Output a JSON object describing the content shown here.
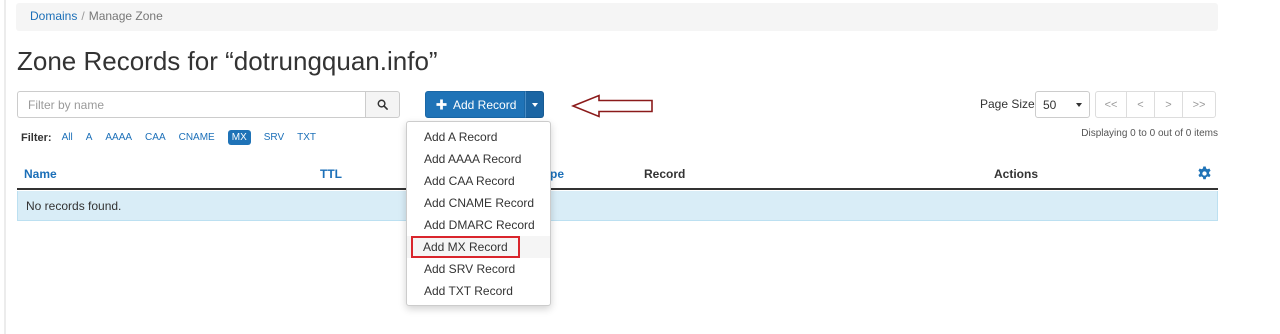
{
  "breadcrumb": {
    "link": "Domains",
    "separator": "/",
    "current": "Manage Zone"
  },
  "page_title": "Zone Records for “dotrungquan.info”",
  "search": {
    "placeholder": "Filter by name",
    "icon": "search-icon"
  },
  "add_record": {
    "label": "Add Record",
    "icon": "plus-icon",
    "color": "#1f73b7"
  },
  "dropdown": {
    "items": [
      "Add A Record",
      "Add AAAA Record",
      "Add CAA Record",
      "Add CNAME Record",
      "Add DMARC Record",
      "Add MX Record",
      "Add SRV Record",
      "Add TXT Record"
    ],
    "highlighted": "Add MX Record",
    "highlight_color": "#d9252c"
  },
  "page_size": {
    "label": "Page Size",
    "value": "50"
  },
  "pager": [
    "<<",
    "<",
    ">",
    ">>"
  ],
  "displaying": "Displaying 0 to 0 out of 0 items",
  "filter": {
    "label": "Filter:",
    "items": [
      "All",
      "A",
      "AAAA",
      "CAA",
      "CNAME",
      "MX",
      "SRV",
      "TXT"
    ],
    "active": "MX"
  },
  "table": {
    "columns": {
      "name": "Name",
      "ttl": "TTL",
      "type": "pe",
      "record": "Record",
      "actions": "Actions"
    },
    "empty_message": "No records found."
  },
  "annotation": {
    "arrow_color": "#8b1a1a"
  }
}
